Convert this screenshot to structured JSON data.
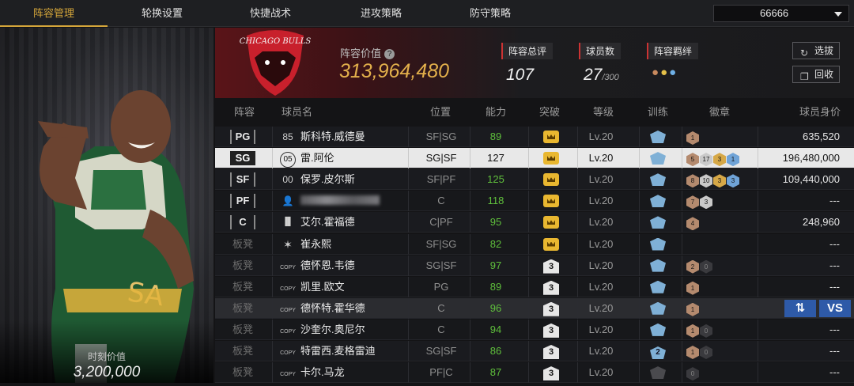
{
  "nav": {
    "tabs": [
      "阵容管理",
      "轮换设置",
      "快捷战术",
      "进攻策略",
      "防守策略"
    ],
    "active": 0,
    "selector_value": "66666"
  },
  "left": {
    "market_value_label": "时刻价值",
    "market_value": "3,200,000"
  },
  "header": {
    "logo_text": "CHICAGO BULLS",
    "value_label": "阵容价值",
    "help_glyph": "?",
    "value": "313,964,480",
    "overall_label": "阵容总评",
    "overall": "107",
    "players_label": "球员数",
    "players": "27",
    "players_max": "/300",
    "bond_label": "阵容羁绊",
    "btn_draft": "选拔",
    "btn_recycle": "回收"
  },
  "table": {
    "headers": [
      "阵容",
      "球员名",
      "位置",
      "能力",
      "突破",
      "等级",
      "训练",
      "徽章",
      "球员身价"
    ],
    "rows": [
      {
        "slot": "PG",
        "num": "85",
        "name": "斯科特.威德曼",
        "pos": "SF|SG",
        "rating": "89",
        "green": true,
        "brk": "crown",
        "lvl": "Lv.20",
        "train": "",
        "badges": [
          [
            "bronze",
            "1"
          ]
        ],
        "price": "635,520",
        "style": "starter"
      },
      {
        "slot": "SG",
        "num": "05",
        "name": "雷.阿伦",
        "pos": "SG|SF",
        "rating": "127",
        "green": false,
        "brk": "crown",
        "lvl": "Lv.20",
        "train": "",
        "badges": [
          [
            "bronze",
            "5"
          ],
          [
            "silver",
            "17"
          ],
          [
            "gold",
            "3"
          ],
          [
            "blue",
            "1"
          ]
        ],
        "price": "196,480,000",
        "style": "selected"
      },
      {
        "slot": "SF",
        "num": "00",
        "name": "保罗.皮尔斯",
        "pos": "SF|PF",
        "rating": "125",
        "green": true,
        "brk": "crown",
        "lvl": "Lv.20",
        "train": "",
        "badges": [
          [
            "bronze",
            "8"
          ],
          [
            "silver",
            "10"
          ],
          [
            "gold",
            "3"
          ],
          [
            "blue",
            "3"
          ]
        ],
        "price": "109,440,000",
        "style": "starter"
      },
      {
        "slot": "PF",
        "num": "avatar",
        "name": "",
        "pos": "C",
        "rating": "118",
        "green": true,
        "brk": "crown",
        "lvl": "Lv.20",
        "train": "",
        "badges": [
          [
            "bronze",
            "7"
          ],
          [
            "silver",
            "3"
          ]
        ],
        "price": "---",
        "style": "starter"
      },
      {
        "slot": "C",
        "num": "bars",
        "name": "艾尔.霍福德",
        "pos": "C|PF",
        "rating": "95",
        "green": true,
        "brk": "crown",
        "lvl": "Lv.20",
        "train": "",
        "badges": [
          [
            "bronze",
            "4"
          ]
        ],
        "price": "248,960",
        "style": "starter"
      },
      {
        "slot": "板凳",
        "num": "star",
        "name": "崔永熙",
        "pos": "SF|SG",
        "rating": "82",
        "green": true,
        "brk": "crown",
        "lvl": "Lv.20",
        "train": "",
        "badges": [],
        "price": "---",
        "style": "bench"
      },
      {
        "slot": "板凳",
        "num": "COPY",
        "name": "德怀恩.韦德",
        "pos": "SG|SF",
        "rating": "97",
        "green": true,
        "brk": "3",
        "lvl": "Lv.20",
        "train": "",
        "badges": [
          [
            "bronze",
            "2"
          ],
          [
            "dark",
            "0"
          ]
        ],
        "price": "---",
        "style": "bench"
      },
      {
        "slot": "板凳",
        "num": "COPY",
        "name": "凯里.欧文",
        "pos": "PG",
        "rating": "89",
        "green": true,
        "brk": "3",
        "lvl": "Lv.20",
        "train": "",
        "badges": [
          [
            "bronze",
            "1"
          ]
        ],
        "price": "---",
        "style": "bench"
      },
      {
        "slot": "板凳",
        "num": "COPY",
        "name": "德怀特.霍华德",
        "pos": "C",
        "rating": "96",
        "green": true,
        "brk": "3",
        "lvl": "Lv.20",
        "train": "",
        "badges": [
          [
            "bronze",
            "1"
          ]
        ],
        "price": "",
        "style": "highlight"
      },
      {
        "slot": "板凳",
        "num": "COPY",
        "name": "沙奎尔.奥尼尔",
        "pos": "C",
        "rating": "94",
        "green": true,
        "brk": "3",
        "lvl": "Lv.20",
        "train": "",
        "badges": [
          [
            "bronze",
            "1"
          ],
          [
            "dark",
            "0"
          ]
        ],
        "price": "---",
        "style": "bench"
      },
      {
        "slot": "板凳",
        "num": "COPY",
        "name": "特雷西.麦格雷迪",
        "pos": "SG|SF",
        "rating": "86",
        "green": true,
        "brk": "3",
        "lvl": "Lv.20",
        "train": "2",
        "badges": [
          [
            "bronze",
            "1"
          ],
          [
            "dark",
            "0"
          ]
        ],
        "price": "---",
        "style": "bench"
      },
      {
        "slot": "板凳",
        "num": "COPY",
        "name": "卡尔.马龙",
        "pos": "PF|C",
        "rating": "87",
        "green": true,
        "brk": "3",
        "lvl": "Lv.20",
        "train": "dim",
        "badges": [
          [
            "dark",
            "0"
          ]
        ],
        "price": "---",
        "style": "bench"
      }
    ],
    "vs_label": "VS",
    "swap_glyph": "⇅"
  }
}
